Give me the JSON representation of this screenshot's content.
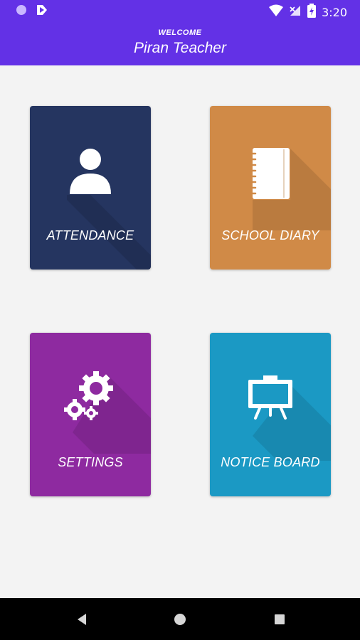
{
  "status_bar": {
    "time": "3:20"
  },
  "header": {
    "welcome": "WELCOME",
    "title": "Piran Teacher",
    "color": "#6331e6"
  },
  "tiles": [
    {
      "label": "ATTENDANCE",
      "icon": "person-icon",
      "color": "#253560"
    },
    {
      "label": "SCHOOL DIARY",
      "icon": "notebook-icon",
      "color": "#d08a47"
    },
    {
      "label": "SETTINGS",
      "icon": "gears-icon",
      "color": "#8e2aa0"
    },
    {
      "label": "NOTICE BOARD",
      "icon": "board-icon",
      "color": "#1b99c4"
    }
  ]
}
